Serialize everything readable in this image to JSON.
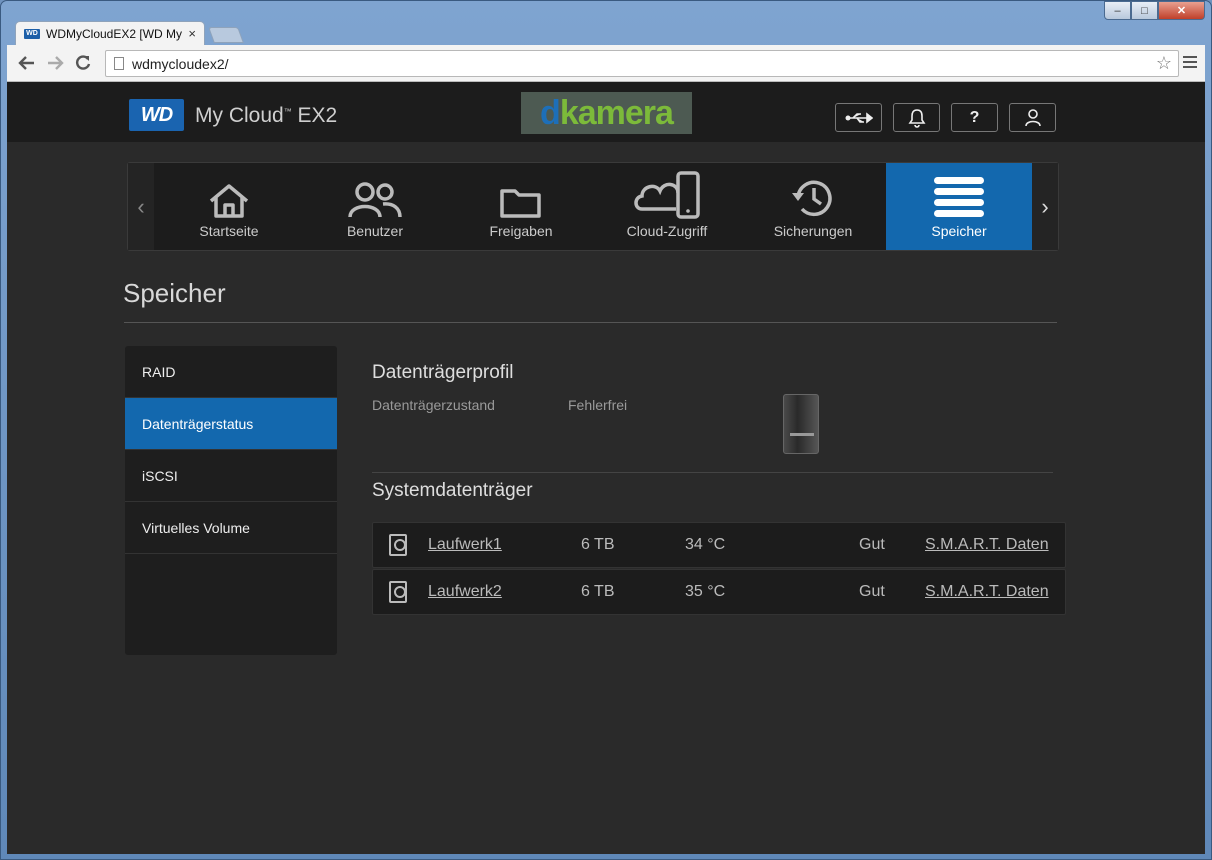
{
  "browser": {
    "tab_title": "WDMyCloudEX2 [WD My",
    "tab_favicon": "WD",
    "tab_close": "×",
    "url": "wdmycloudex2/",
    "controls": {
      "minimize": "–",
      "maximize": "□",
      "close": "✕"
    }
  },
  "header": {
    "logo": "WD",
    "product": "My Cloud",
    "product_tm": "™",
    "product_model": " EX2",
    "overlay_logo_d": "d",
    "overlay_logo_rest": "kamera",
    "buttons": [
      "usb-icon",
      "bell-icon",
      "help-icon",
      "user-icon"
    ],
    "help_glyph": "?"
  },
  "nav": {
    "items": [
      {
        "label": "Startseite",
        "icon": "home-icon"
      },
      {
        "label": "Benutzer",
        "icon": "users-icon"
      },
      {
        "label": "Freigaben",
        "icon": "folder-icon"
      },
      {
        "label": "Cloud-Zugriff",
        "icon": "cloud-icon"
      },
      {
        "label": "Sicherungen",
        "icon": "history-icon"
      },
      {
        "label": "Speicher",
        "icon": "storage-icon"
      }
    ],
    "active": "Speicher",
    "prev": "‹",
    "next": "›"
  },
  "page": {
    "title": "Speicher"
  },
  "sidebar": {
    "items": [
      {
        "label": "RAID"
      },
      {
        "label": "Datenträgerstatus"
      },
      {
        "label": "iSCSI"
      },
      {
        "label": "Virtuelles Volume"
      }
    ],
    "active": "Datenträgerstatus"
  },
  "profile": {
    "title": "Datenträgerprofil",
    "status_label": "Datenträgerzustand",
    "status_value": "Fehlerfrei"
  },
  "system_drives": {
    "title": "Systemdatenträger",
    "rows": [
      {
        "name": "Laufwerk1",
        "size": "6 TB",
        "temp": "34 °C",
        "health": "Gut",
        "smart": "S.M.A.R.T. Daten"
      },
      {
        "name": "Laufwerk2",
        "size": "6 TB",
        "temp": "35 °C",
        "health": "Gut",
        "smart": "S.M.A.R.T. Daten"
      }
    ]
  },
  "colors": {
    "accent": "#1368ae",
    "background": "#2a2a2a",
    "header": "#1c1c1c"
  }
}
